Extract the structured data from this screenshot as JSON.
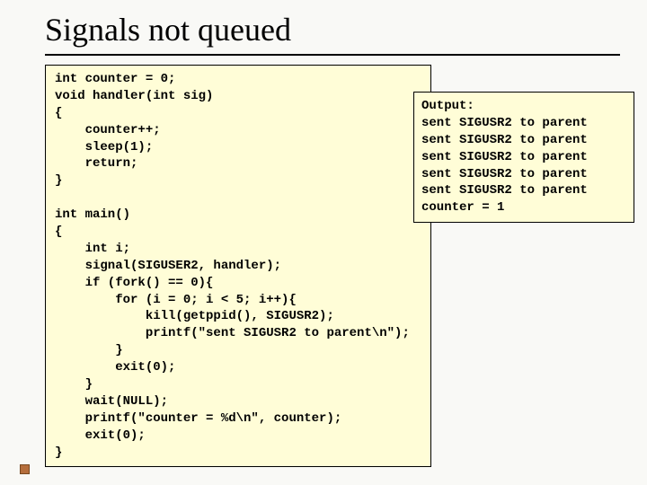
{
  "title": "Signals not queued",
  "code": "int counter = 0;\nvoid handler(int sig)\n{\n    counter++;\n    sleep(1);\n    return;\n}\n\nint main()\n{\n    int i;\n    signal(SIGUSER2, handler);\n    if (fork() == 0){\n        for (i = 0; i < 5; i++){\n            kill(getppid(), SIGUSR2);\n            printf(\"sent SIGUSR2 to parent\\n\");\n        }\n        exit(0);\n    }\n    wait(NULL);\n    printf(\"counter = %d\\n\", counter);\n    exit(0);\n}",
  "output": "Output:\nsent SIGUSR2 to parent\nsent SIGUSR2 to parent\nsent SIGUSR2 to parent\nsent SIGUSR2 to parent\nsent SIGUSR2 to parent\ncounter = 1"
}
